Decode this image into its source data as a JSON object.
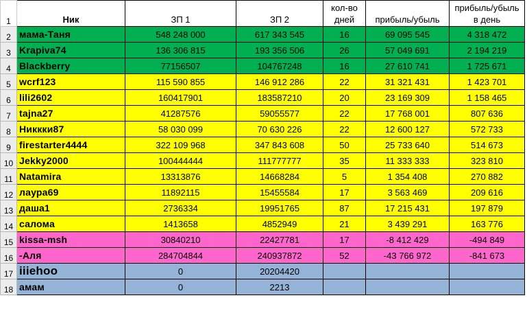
{
  "header": {
    "row_number": "1",
    "nick": "Ник",
    "zp1": "ЗП 1",
    "zp2": "ЗП 2",
    "days_line1": "кол-во",
    "days_line2": "дней",
    "profit": "прибыль/убыль",
    "profit_day_line1": "прибыль/убыль",
    "profit_day_line2": "в день"
  },
  "rows": [
    {
      "n": "2",
      "nick": "мама-Таня",
      "zp1": "548 248 000",
      "zp2": "617 343 545",
      "days": "16",
      "profit": "69 095 545",
      "per_day": "4 318 472",
      "color": "green"
    },
    {
      "n": "3",
      "nick": "Krapiva74",
      "zp1": "136 306 815",
      "zp2": "193 356 506",
      "days": "26",
      "profit": "57 049 691",
      "per_day": "2 194 219",
      "color": "green"
    },
    {
      "n": "4",
      "nick": "Blackberry",
      "zp1": "77156507",
      "zp2": "104767248",
      "days": "16",
      "profit": "27 610 741",
      "per_day": "1 725 671",
      "color": "green"
    },
    {
      "n": "5",
      "nick": "wcrf123",
      "zp1": "115 590 855",
      "zp2": "146 912 286",
      "days": "22",
      "profit": "31 321 431",
      "per_day": "1 423 701",
      "color": "yellow"
    },
    {
      "n": "6",
      "nick": "lili2602",
      "zp1": "160417901",
      "zp2": "183587210",
      "days": "20",
      "profit": "23 169 309",
      "per_day": "1 158 465",
      "color": "yellow"
    },
    {
      "n": "7",
      "nick": "tajna27",
      "zp1": "41287576",
      "zp2": "59055577",
      "days": "22",
      "profit": "17 768 001",
      "per_day": "807 636",
      "color": "yellow"
    },
    {
      "n": "8",
      "nick": "Никкки87",
      "zp1": "58 030 099",
      "zp2": "70 630 226",
      "days": "22",
      "profit": "12 600 127",
      "per_day": "572 733",
      "color": "yellow"
    },
    {
      "n": "9",
      "nick": "firestarter4444",
      "zp1": "322 109 968",
      "zp2": "347 843 608",
      "days": "50",
      "profit": "25 733 640",
      "per_day": "514 673",
      "color": "yellow"
    },
    {
      "n": "10",
      "nick": "Jekky2000",
      "zp1": "100444444",
      "zp2": "111777777",
      "days": "35",
      "profit": "11 333 333",
      "per_day": "323 810",
      "color": "yellow"
    },
    {
      "n": "11",
      "nick": "Natamira",
      "zp1": "13313876",
      "zp2": "14668284",
      "days": "5",
      "profit": "1 354 408",
      "per_day": "270 882",
      "color": "yellow"
    },
    {
      "n": "12",
      "nick": "лаура69",
      "zp1": "11892115",
      "zp2": "15455584",
      "days": "17",
      "profit": "3 563 469",
      "per_day": "209 616",
      "color": "yellow"
    },
    {
      "n": "13",
      "nick": "даша1",
      "zp1": "2736334",
      "zp2": "19951765",
      "days": "87",
      "profit": "17 215 431",
      "per_day": "197 879",
      "color": "yellow"
    },
    {
      "n": "14",
      "nick": "салома",
      "zp1": "1413658",
      "zp2": "4852949",
      "days": "21",
      "profit": "3 439 291",
      "per_day": "163 776",
      "color": "yellow"
    },
    {
      "n": "15",
      "nick": "kissa-msh",
      "zp1": "30840210",
      "zp2": "22427781",
      "days": "17",
      "profit": "-8 412 429",
      "per_day": "-494 849",
      "color": "pink"
    },
    {
      "n": "16",
      "nick": "-Аля",
      "zp1": "284704844",
      "zp2": "240937872",
      "days": "52",
      "profit": "-43 766 972",
      "per_day": "-841 673",
      "color": "pink"
    },
    {
      "n": "17",
      "nick": "iiiehoo",
      "zp1": "0",
      "zp2": "20204420",
      "days": "",
      "profit": "",
      "per_day": "",
      "color": "blue"
    },
    {
      "n": "18",
      "nick": "амам",
      "zp1": "0",
      "zp2": "2213",
      "days": "",
      "profit": "",
      "per_day": "",
      "color": "blue"
    }
  ],
  "colors": {
    "green": "#00b050",
    "yellow": "#ffff00",
    "pink": "#ff66cc",
    "blue": "#95b3d7"
  }
}
